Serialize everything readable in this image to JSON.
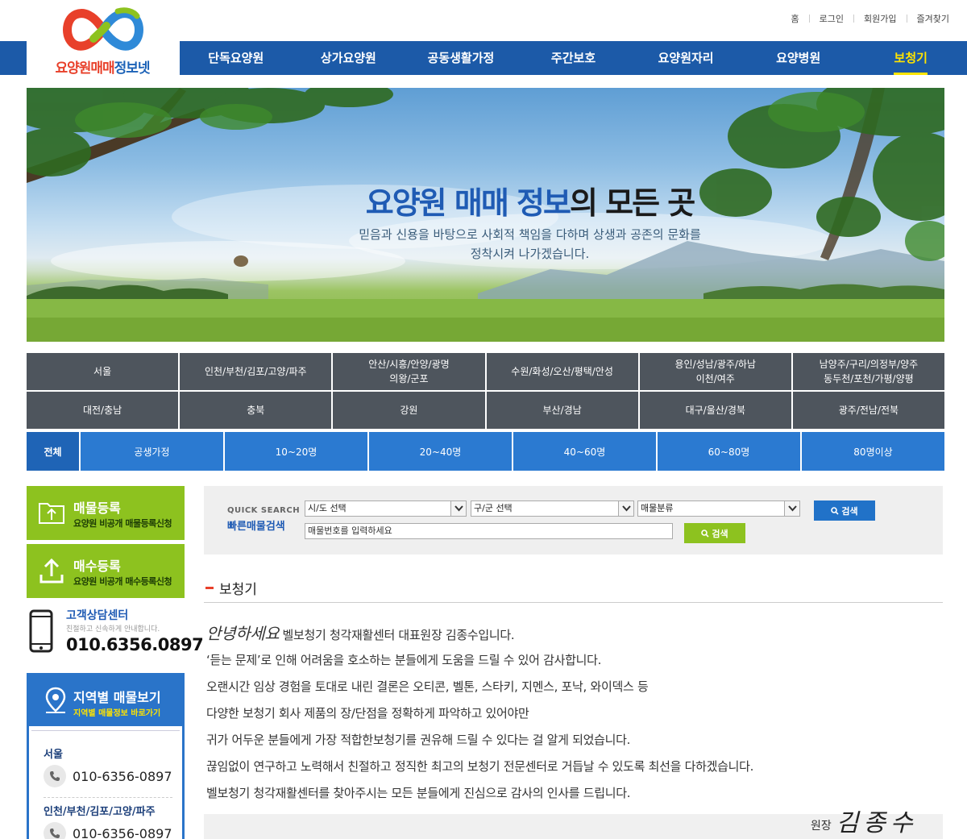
{
  "top_links": [
    "홈",
    "로그인",
    "회원가입",
    "즐겨찾기"
  ],
  "logo": {
    "part1": "요양원매매",
    "part2": "정보넷"
  },
  "nav": [
    {
      "label": "단독요양원",
      "active": false
    },
    {
      "label": "상가요양원",
      "active": false
    },
    {
      "label": "공동생활가정",
      "active": false
    },
    {
      "label": "주간보호",
      "active": false
    },
    {
      "label": "요양원자리",
      "active": false
    },
    {
      "label": "요양병원",
      "active": false
    },
    {
      "label": "보청기",
      "active": true
    }
  ],
  "banner": {
    "headline_highlight": "요양원 매매 정보",
    "headline_rest": "의 모든 곳",
    "sub_line1": "믿음과 신용을 바탕으로 사회적 책임을 다하며 상생과 공존의 문화를",
    "sub_line2": "정착시켜 나가겠습니다."
  },
  "regions": [
    "서울",
    "인천/부천/김포/고양/파주",
    "안산/시흥/안양/광명\n의왕/군포",
    "수원/화성/오산/평택/안성",
    "용인/성남/광주/하남\n이천/여주",
    "남양주/구리/의정부/양주\n동두천/포천/가평/양평",
    "대전/충남",
    "충북",
    "강원",
    "부산/경남",
    "대구/울산/경북",
    "광주/전남/전북"
  ],
  "sizes": {
    "all": "전체",
    "items": [
      "공생가정",
      "10~20명",
      "20~40명",
      "40~60명",
      "60~80명",
      "80명이상"
    ]
  },
  "sidebar": {
    "register_sale": {
      "title": "매물등록",
      "desc": "요양원 비공개 매물등록신청"
    },
    "register_buy": {
      "title": "매수등록",
      "desc": "요양원 비공개 매수등록신청"
    },
    "customer_center": {
      "title": "고객상담센터",
      "desc": "친절하고 신속하게 안내합니다.",
      "phone": "010.6356.0897"
    },
    "area_box": {
      "title": "지역별 매물보기",
      "desc": "지역별 매물정보 바로가기",
      "entries": [
        {
          "region": "서울",
          "phone": "010-6356-0897"
        },
        {
          "region": "인천/부천/김포/고양/파주",
          "phone": "010-6356-0897"
        }
      ]
    }
  },
  "quick_search": {
    "label_en": "QUICK SEARCH",
    "label_ko": "빠른매물검색",
    "select_sido": "시/도 선택",
    "select_gugun": "구/군 선택",
    "select_category": "매물분류",
    "search_label": "검색",
    "item_number_placeholder": "매물번호를 입력하세요",
    "search_label2": "검색"
  },
  "content": {
    "section_title": "보청기",
    "greeting_script": "안녕하세요",
    "lines": [
      "벨보청기 청각재활센터 대표원장 김종수입니다.",
      "‘듣는 문제’로 인해 어려움을 호소하는 분들에게 도움을 드릴 수 있어 감사합니다.",
      "오랜시간 임상 경험을 토대로 내린 결론은 오티콘, 벨톤, 스타키, 지멘스, 포낙, 와이덱스 등",
      "다양한 보청기 회사 제품의 장/단점을 정확하게 파악하고 있어야만",
      "귀가 어두운 분들에게 가장 적합한보청기를 권유해 드릴 수 있다는 걸 알게 되었습니다.",
      "끊임없이 연구하고 노력해서 친절하고 정직한 최고의 보청기 전문센터로 거듭날 수 있도록 최선을 다하겠습니다.",
      "벨보청기 청각재활센터를 찾아주시는 모든 분들에게 진심으로 감사의 인사를 드립니다."
    ],
    "signature_role": "원장",
    "signature_name": "김종수"
  },
  "colors": {
    "nav_blue": "#1c5aa8",
    "accent_yellow": "#ffe400",
    "green": "#8dc21f",
    "region_gray": "#4e555d",
    "size_blue": "#2b7ad1"
  }
}
